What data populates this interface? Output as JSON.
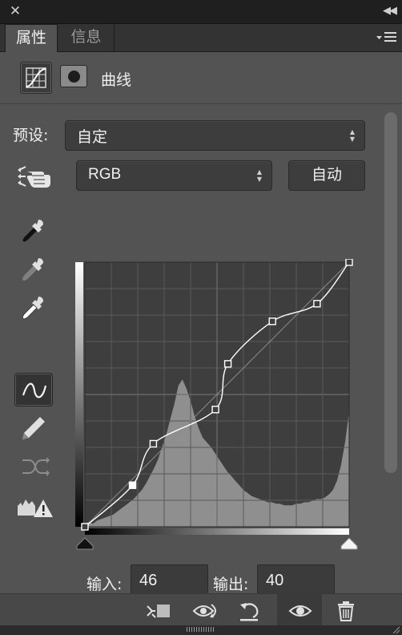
{
  "window": {
    "close_icon": "close-icon",
    "collapse_icon": "double-chevron-left-icon"
  },
  "tabs": [
    {
      "label": "属性",
      "active": true
    },
    {
      "label": "信息",
      "active": false
    }
  ],
  "panel_menu_icon": "panel-menu-icon",
  "header": {
    "title": "曲线",
    "icons": [
      "curves-adjustment-icon",
      "layer-mask-icon"
    ]
  },
  "preset": {
    "label": "预设:",
    "value": "自定"
  },
  "channel": {
    "value": "RGB"
  },
  "auto_label": "自动",
  "tools": [
    {
      "name": "target-adjust-hand-icon"
    },
    {
      "name": "black-point-eyedropper-icon"
    },
    {
      "name": "gray-point-eyedropper-icon"
    },
    {
      "name": "white-point-eyedropper-icon"
    },
    {
      "name": "curve-point-edit-icon",
      "selected": true
    },
    {
      "name": "pencil-draw-icon"
    },
    {
      "name": "smooth-curve-icon"
    },
    {
      "name": "clipping-warning-icon"
    }
  ],
  "curve": {
    "input_range": [
      0,
      255
    ],
    "output_range": [
      0,
      255
    ],
    "grid_divisions": 10,
    "points": [
      {
        "in": 0,
        "out": 0
      },
      {
        "in": 46,
        "out": 40,
        "selected": true
      },
      {
        "in": 66,
        "out": 80
      },
      {
        "in": 126,
        "out": 113
      },
      {
        "in": 138,
        "out": 157
      },
      {
        "in": 181,
        "out": 198
      },
      {
        "in": 224,
        "out": 215
      },
      {
        "in": 255,
        "out": 255
      }
    ],
    "histogram": [
      2,
      3,
      2,
      4,
      5,
      6,
      7,
      8,
      10,
      12,
      14,
      16,
      18,
      21,
      24,
      28,
      33,
      38,
      44,
      52,
      60,
      70,
      80,
      92,
      96,
      90,
      82,
      72,
      64,
      58,
      55,
      52,
      48,
      44,
      40,
      36,
      33,
      30,
      27,
      24,
      22,
      20,
      19,
      18,
      17,
      16,
      16,
      15,
      15,
      14,
      14,
      14,
      15,
      15,
      16,
      16,
      17,
      18,
      18,
      19,
      21,
      24,
      30,
      40,
      55,
      75
    ]
  },
  "io": {
    "input_label": "输入:",
    "input_value": "46",
    "output_label": "输出:",
    "output_value": "40"
  },
  "footer": {
    "buttons": [
      "clip-to-layer-icon",
      "view-previous-state-icon",
      "reset-icon",
      "toggle-visibility-icon",
      "delete-icon"
    ]
  }
}
